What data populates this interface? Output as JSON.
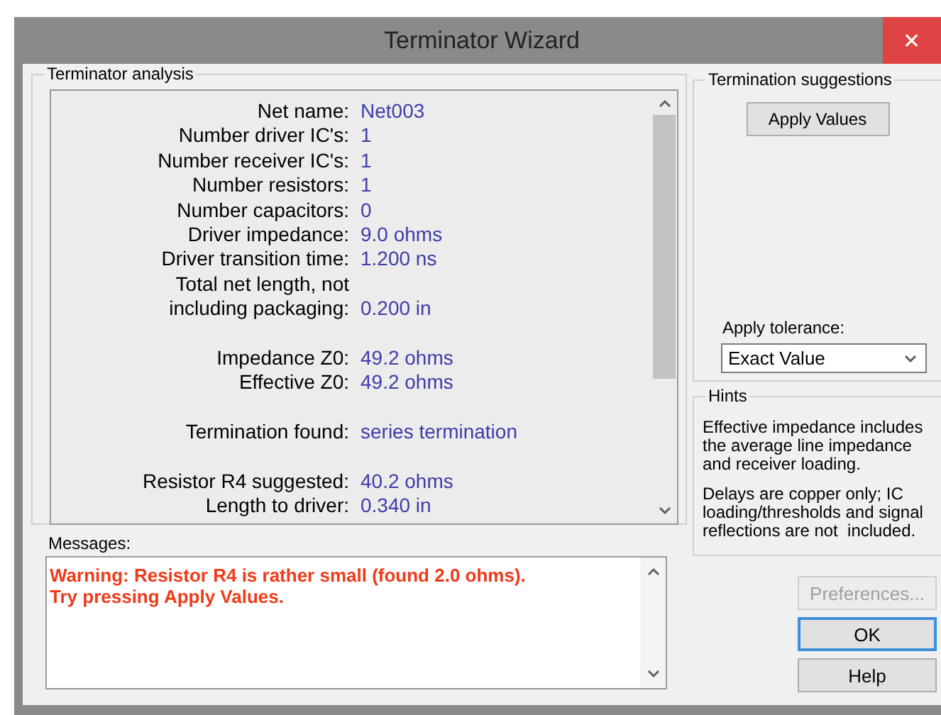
{
  "window": {
    "title": "Terminator Wizard",
    "close": "✕"
  },
  "analysis": {
    "title": "Terminator analysis",
    "rows": [
      {
        "kind": "field",
        "label": "Net name:",
        "value": "Net003"
      },
      {
        "kind": "field",
        "label": "Number driver IC's:",
        "value": "1"
      },
      {
        "kind": "field",
        "label": "Number receiver IC's:",
        "value": "1"
      },
      {
        "kind": "field",
        "label": "Number resistors:",
        "value": "1"
      },
      {
        "kind": "field",
        "label": "Number capacitors:",
        "value": "0"
      },
      {
        "kind": "field",
        "label": "Driver impedance:",
        "value": "9.0 ohms"
      },
      {
        "kind": "field",
        "label": "Driver transition time:",
        "value": "1.200 ns"
      },
      {
        "kind": "field",
        "label": "Total net length, not"
      },
      {
        "kind": "field",
        "label": "including packaging:",
        "value": "0.200 in"
      },
      {
        "kind": "blank"
      },
      {
        "kind": "field",
        "label": "Impedance Z0:",
        "value": "49.2 ohms"
      },
      {
        "kind": "field",
        "label": "Effective Z0:",
        "value": "49.2 ohms"
      },
      {
        "kind": "blank"
      },
      {
        "kind": "field",
        "label": "Termination found:",
        "value": "series termination"
      },
      {
        "kind": "blank"
      },
      {
        "kind": "field",
        "label": "Resistor R4 suggested:",
        "value": "40.2 ohms"
      },
      {
        "kind": "field",
        "label": "Length to driver:",
        "value": "0.340 in"
      }
    ]
  },
  "messages": {
    "label": "Messages:",
    "lines": [
      "Warning: Resistor R4 is rather small (found 2.0 ohms).",
      "Try pressing Apply Values."
    ]
  },
  "suggestions": {
    "title": "Termination suggestions",
    "apply_button": "Apply Values",
    "tolerance_label": "Apply tolerance:",
    "tolerance_value": "Exact Value"
  },
  "hints": {
    "title": "Hints",
    "paragraphs": [
      "Effective impedance includes the average line impedance and receiver loading.",
      "Delays are copper only; IC loading/thresholds and signal reflections are not  included."
    ]
  },
  "buttons": [
    {
      "label": "Preferences...",
      "disabled": true,
      "default": false
    },
    {
      "label": "OK",
      "disabled": false,
      "default": true
    },
    {
      "label": "Help",
      "disabled": false,
      "default": false
    }
  ]
}
